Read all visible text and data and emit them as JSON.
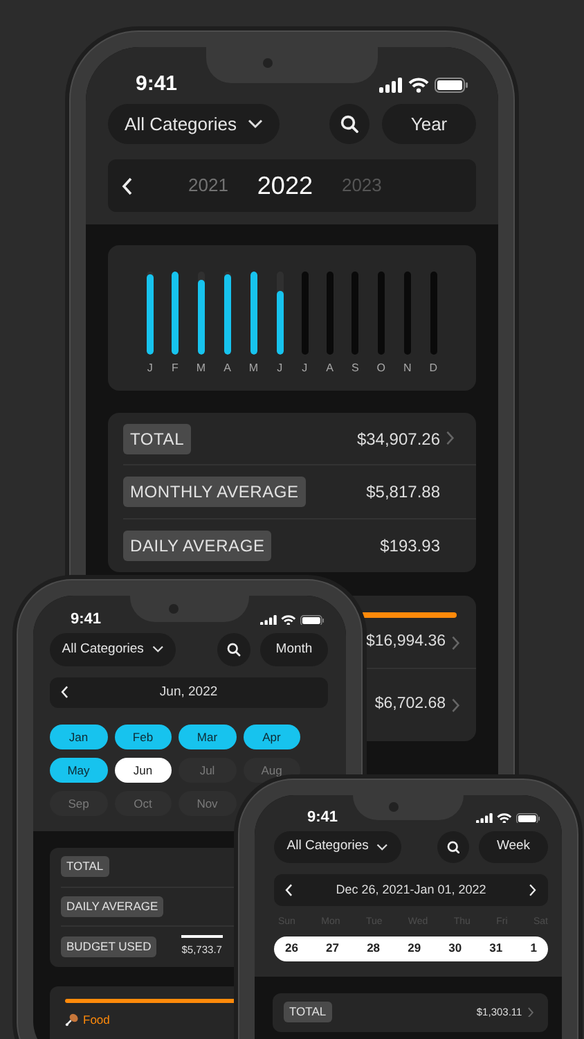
{
  "year_screen": {
    "time": "9:41",
    "category_filter": "All Categories",
    "period": "Year",
    "years": [
      {
        "label": "2021",
        "selected": false,
        "disabled": false
      },
      {
        "label": "2022",
        "selected": true,
        "disabled": false
      },
      {
        "label": "2023",
        "selected": false,
        "disabled": true
      }
    ],
    "months": [
      {
        "label": "J",
        "level": 0.97,
        "future": false
      },
      {
        "label": "F",
        "level": 1,
        "future": false
      },
      {
        "label": "M",
        "level": 0.9,
        "future": false
      },
      {
        "label": "A",
        "level": 0.97,
        "future": false
      },
      {
        "label": "M",
        "level": 1,
        "future": false
      },
      {
        "label": "J",
        "level": 0.77,
        "future": false
      },
      {
        "label": "J",
        "future": true
      },
      {
        "label": "A",
        "future": true
      },
      {
        "label": "S",
        "future": true
      },
      {
        "label": "O",
        "future": true
      },
      {
        "label": "N",
        "future": true
      },
      {
        "label": "D",
        "future": true
      }
    ],
    "totals": [
      {
        "label": "TOTAL",
        "value": "$34,907.26",
        "link": true
      },
      {
        "label": "MONTHLY AVERAGE",
        "value": "$5,817.88",
        "link": false
      },
      {
        "label": "DAILY AVERAGE",
        "value": "$193.93",
        "link": false
      }
    ],
    "categories": [
      {
        "amount": "$16,994.36",
        "color": "#ff8a0a",
        "link": true
      },
      {
        "amount": "$6,702.68",
        "link": true
      }
    ]
  },
  "month_screen": {
    "time": "9:41",
    "category_filter": "All Categories",
    "period": "Month",
    "date": "Jun, 2022",
    "months": [
      {
        "label": "Jan",
        "selected": false,
        "disabled": false
      },
      {
        "label": "Feb",
        "selected": false,
        "disabled": false
      },
      {
        "label": "Mar",
        "selected": false,
        "disabled": false
      },
      {
        "label": "Apr",
        "selected": false,
        "disabled": false
      },
      {
        "label": "May",
        "selected": false,
        "disabled": false
      },
      {
        "label": "Jun",
        "selected": true,
        "disabled": false
      },
      {
        "label": "Jul",
        "selected": false,
        "disabled": true
      },
      {
        "label": "Aug",
        "selected": false,
        "disabled": true
      },
      {
        "label": "Sep",
        "selected": false,
        "disabled": true
      },
      {
        "label": "Oct",
        "selected": false,
        "disabled": true
      },
      {
        "label": "Nov",
        "selected": false,
        "disabled": true
      }
    ],
    "stats": [
      {
        "label": "TOTAL"
      },
      {
        "label": "DAILY AVERAGE"
      },
      {
        "label": "BUDGET USED",
        "value": "$5,733.7"
      }
    ],
    "category": {
      "label": "Food",
      "color": "#ff8a0a"
    }
  },
  "week_screen": {
    "time": "9:41",
    "category_filter": "All Categories",
    "period": "Week",
    "date": "Dec 26, 2021-Jan 01, 2022",
    "weekdays": [
      "Sun",
      "Mon",
      "Tue",
      "Wed",
      "Thu",
      "Fri",
      "Sat"
    ],
    "week_selected": true,
    "days": [
      "26",
      "27",
      "28",
      "29",
      "30",
      "31",
      "1"
    ],
    "totals": [
      {
        "label": "TOTAL",
        "value": "$1,303.11",
        "link": true
      }
    ]
  }
}
